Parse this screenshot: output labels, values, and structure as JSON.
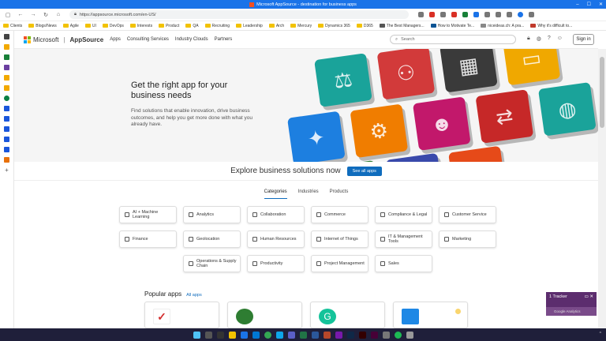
{
  "browser": {
    "window_title": "Microsoft AppSource - destination for business apps",
    "url": "https://appsource.microsoft.com/en-US/",
    "window_controls": [
      "–",
      "☐",
      "✕"
    ]
  },
  "bookmarks": [
    "Clients",
    "Blogs/News",
    "Agile",
    "UI",
    "DevOps",
    "Interests",
    "Product",
    "QA",
    "Recruiting",
    "Leadership",
    "Arch",
    "Mercury",
    "Dynamics 365",
    "D365",
    "The Best Managers...",
    "How to Motivate Te...",
    "niceideas.ch: A pra...",
    "Why it's difficult to..."
  ],
  "header": {
    "brand": "Microsoft",
    "product": "AppSource",
    "nav": [
      "Apps",
      "Consulting Services",
      "Industry Clouds",
      "Partners"
    ],
    "search_placeholder": "Search",
    "signin": "Sign in"
  },
  "hero": {
    "title": "Get the right app for your business needs",
    "subtitle": "Find solutions that enable innovation, drive business outcomes, and help you get more done with what you already have."
  },
  "explore": {
    "title": "Explore business solutions now",
    "button": "See all apps"
  },
  "tabs": [
    {
      "label": "Categories",
      "active": true
    },
    {
      "label": "Industries",
      "active": false
    },
    {
      "label": "Products",
      "active": false
    }
  ],
  "categories": [
    [
      "AI + Machine Learning",
      "Analytics",
      "Collaboration",
      "Commerce",
      "Compliance & Legal",
      "Customer Service"
    ],
    [
      "Finance",
      "Geolocation",
      "Human Resources",
      "Internet of Things",
      "IT & Management Tools",
      "Marketing"
    ],
    [
      "Operations & Supply Chain",
      "Productivity",
      "Project Management",
      "Sales"
    ]
  ],
  "popular": {
    "title": "Popular apps",
    "link": "All apps"
  },
  "tracker": {
    "title": "1 Tracker",
    "footer": "Google Analytics"
  },
  "colors": {
    "accent": "#0f6cbd",
    "tracker": "#5c2d6e",
    "taskbar": "#1f1f3a"
  }
}
